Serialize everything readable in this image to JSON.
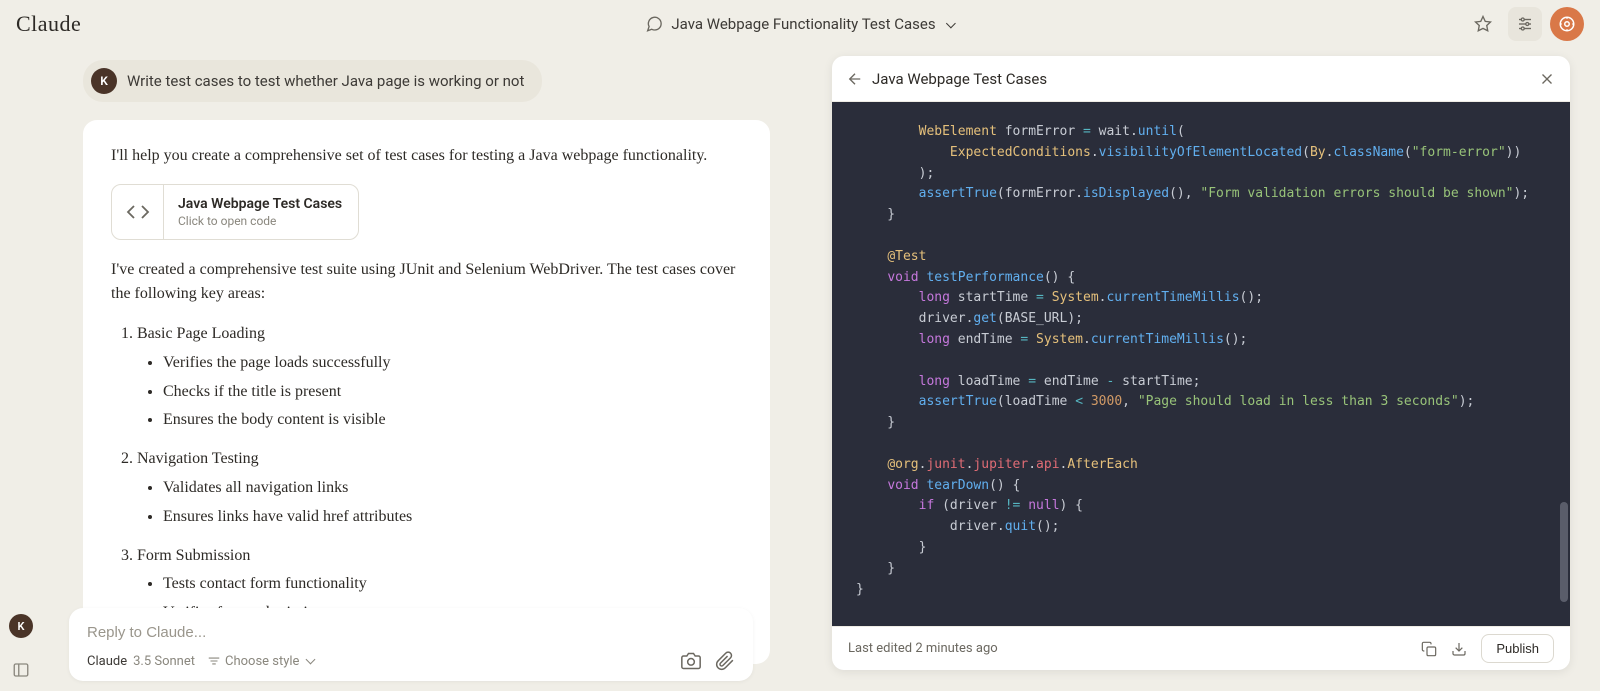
{
  "header": {
    "logo": "Claude",
    "title": "Java Webpage Functionality Test Cases"
  },
  "user_message": {
    "avatar_letter": "K",
    "text": "Write test cases to test whether Java page is working or not"
  },
  "assistant": {
    "intro": "I'll help you create a comprehensive set of test cases for testing a Java webpage functionality.",
    "artifact_chip": {
      "title": "Java Webpage Test Cases",
      "subtitle": "Click to open code"
    },
    "summary": "I've created a comprehensive test suite using JUnit and Selenium WebDriver. The test cases cover the following key areas:",
    "sections": [
      {
        "heading": "Basic Page Loading",
        "items": [
          "Verifies the page loads successfully",
          "Checks if the title is present",
          "Ensures the body content is visible"
        ]
      },
      {
        "heading": "Navigation Testing",
        "items": [
          "Validates all navigation links",
          "Ensures links have valid href attributes"
        ]
      },
      {
        "heading": "Form Submission",
        "items": [
          "Tests contact form functionality",
          "Verifies form submission success messages"
        ]
      }
    ]
  },
  "composer": {
    "avatar_letter": "K",
    "placeholder": "Reply to Claude...",
    "model_name": "Claude",
    "model_version": "3.5 Sonnet",
    "style_label": "Choose style"
  },
  "artifact_panel": {
    "title": "Java Webpage Test Cases",
    "footer_status": "Last edited 2 minutes ago",
    "publish_label": "Publish",
    "code_lines": [
      {
        "indent": 8,
        "tokens": [
          [
            "type",
            "WebElement"
          ],
          [
            "",
            " formError "
          ],
          [
            "op",
            "="
          ],
          [
            "",
            " wait."
          ],
          [
            "fn",
            "until"
          ],
          [
            "",
            "("
          ]
        ]
      },
      {
        "indent": 12,
        "tokens": [
          [
            "type",
            "ExpectedConditions"
          ],
          [
            "",
            "."
          ],
          [
            "fn",
            "visibilityOfElementLocated"
          ],
          [
            "",
            "("
          ],
          [
            "type",
            "By"
          ],
          [
            "",
            "."
          ],
          [
            "fn",
            "className"
          ],
          [
            "",
            "("
          ],
          [
            "str",
            "\"form-error\""
          ],
          [
            "",
            "))"
          ]
        ]
      },
      {
        "indent": 8,
        "tokens": [
          [
            "",
            ");"
          ]
        ]
      },
      {
        "indent": 8,
        "tokens": [
          [
            "fn",
            "assertTrue"
          ],
          [
            "",
            "(formError."
          ],
          [
            "fn",
            "isDisplayed"
          ],
          [
            "",
            "(), "
          ],
          [
            "str",
            "\"Form validation errors should be shown\""
          ],
          [
            "",
            ");"
          ]
        ]
      },
      {
        "indent": 4,
        "tokens": [
          [
            "",
            "}"
          ]
        ]
      },
      {
        "indent": 0,
        "tokens": [
          [
            "",
            ""
          ]
        ]
      },
      {
        "indent": 4,
        "tokens": [
          [
            "ann",
            "@Test"
          ]
        ]
      },
      {
        "indent": 4,
        "tokens": [
          [
            "kw",
            "void"
          ],
          [
            "",
            " "
          ],
          [
            "fn",
            "testPerformance"
          ],
          [
            "",
            "() {"
          ]
        ]
      },
      {
        "indent": 8,
        "tokens": [
          [
            "kw",
            "long"
          ],
          [
            "",
            " startTime "
          ],
          [
            "op",
            "="
          ],
          [
            "",
            " "
          ],
          [
            "type",
            "System"
          ],
          [
            "",
            "."
          ],
          [
            "fn",
            "currentTimeMillis"
          ],
          [
            "",
            "();"
          ]
        ]
      },
      {
        "indent": 8,
        "tokens": [
          [
            "",
            "driver."
          ],
          [
            "fn",
            "get"
          ],
          [
            "",
            "(BASE_URL);"
          ]
        ]
      },
      {
        "indent": 8,
        "tokens": [
          [
            "kw",
            "long"
          ],
          [
            "",
            " endTime "
          ],
          [
            "op",
            "="
          ],
          [
            "",
            " "
          ],
          [
            "type",
            "System"
          ],
          [
            "",
            "."
          ],
          [
            "fn",
            "currentTimeMillis"
          ],
          [
            "",
            "();"
          ]
        ]
      },
      {
        "indent": 0,
        "tokens": [
          [
            "",
            ""
          ]
        ]
      },
      {
        "indent": 8,
        "tokens": [
          [
            "kw",
            "long"
          ],
          [
            "",
            " loadTime "
          ],
          [
            "op",
            "="
          ],
          [
            "",
            " endTime "
          ],
          [
            "op",
            "-"
          ],
          [
            "",
            " startTime;"
          ]
        ]
      },
      {
        "indent": 8,
        "tokens": [
          [
            "fn",
            "assertTrue"
          ],
          [
            "",
            "(loadTime "
          ],
          [
            "op",
            "<"
          ],
          [
            "",
            " "
          ],
          [
            "num",
            "3000"
          ],
          [
            "",
            ", "
          ],
          [
            "str",
            "\"Page should load in less than 3 seconds\""
          ],
          [
            "",
            ");"
          ]
        ]
      },
      {
        "indent": 4,
        "tokens": [
          [
            "",
            "}"
          ]
        ]
      },
      {
        "indent": 0,
        "tokens": [
          [
            "",
            ""
          ]
        ]
      },
      {
        "indent": 4,
        "tokens": [
          [
            "ann",
            "@org"
          ],
          [
            "",
            "."
          ],
          [
            "id",
            "junit"
          ],
          [
            "",
            "."
          ],
          [
            "id",
            "jupiter"
          ],
          [
            "",
            "."
          ],
          [
            "id",
            "api"
          ],
          [
            "",
            "."
          ],
          [
            "type",
            "AfterEach"
          ]
        ]
      },
      {
        "indent": 4,
        "tokens": [
          [
            "kw",
            "void"
          ],
          [
            "",
            " "
          ],
          [
            "fn",
            "tearDown"
          ],
          [
            "",
            "() {"
          ]
        ]
      },
      {
        "indent": 8,
        "tokens": [
          [
            "kw",
            "if"
          ],
          [
            "",
            " (driver "
          ],
          [
            "op",
            "!="
          ],
          [
            "",
            " "
          ],
          [
            "kw",
            "null"
          ],
          [
            "",
            ") {"
          ]
        ]
      },
      {
        "indent": 12,
        "tokens": [
          [
            "",
            "driver."
          ],
          [
            "fn",
            "quit"
          ],
          [
            "",
            "();"
          ]
        ]
      },
      {
        "indent": 8,
        "tokens": [
          [
            "",
            "}"
          ]
        ]
      },
      {
        "indent": 4,
        "tokens": [
          [
            "",
            "}"
          ]
        ]
      },
      {
        "indent": 0,
        "tokens": [
          [
            "",
            "}"
          ]
        ]
      }
    ]
  }
}
